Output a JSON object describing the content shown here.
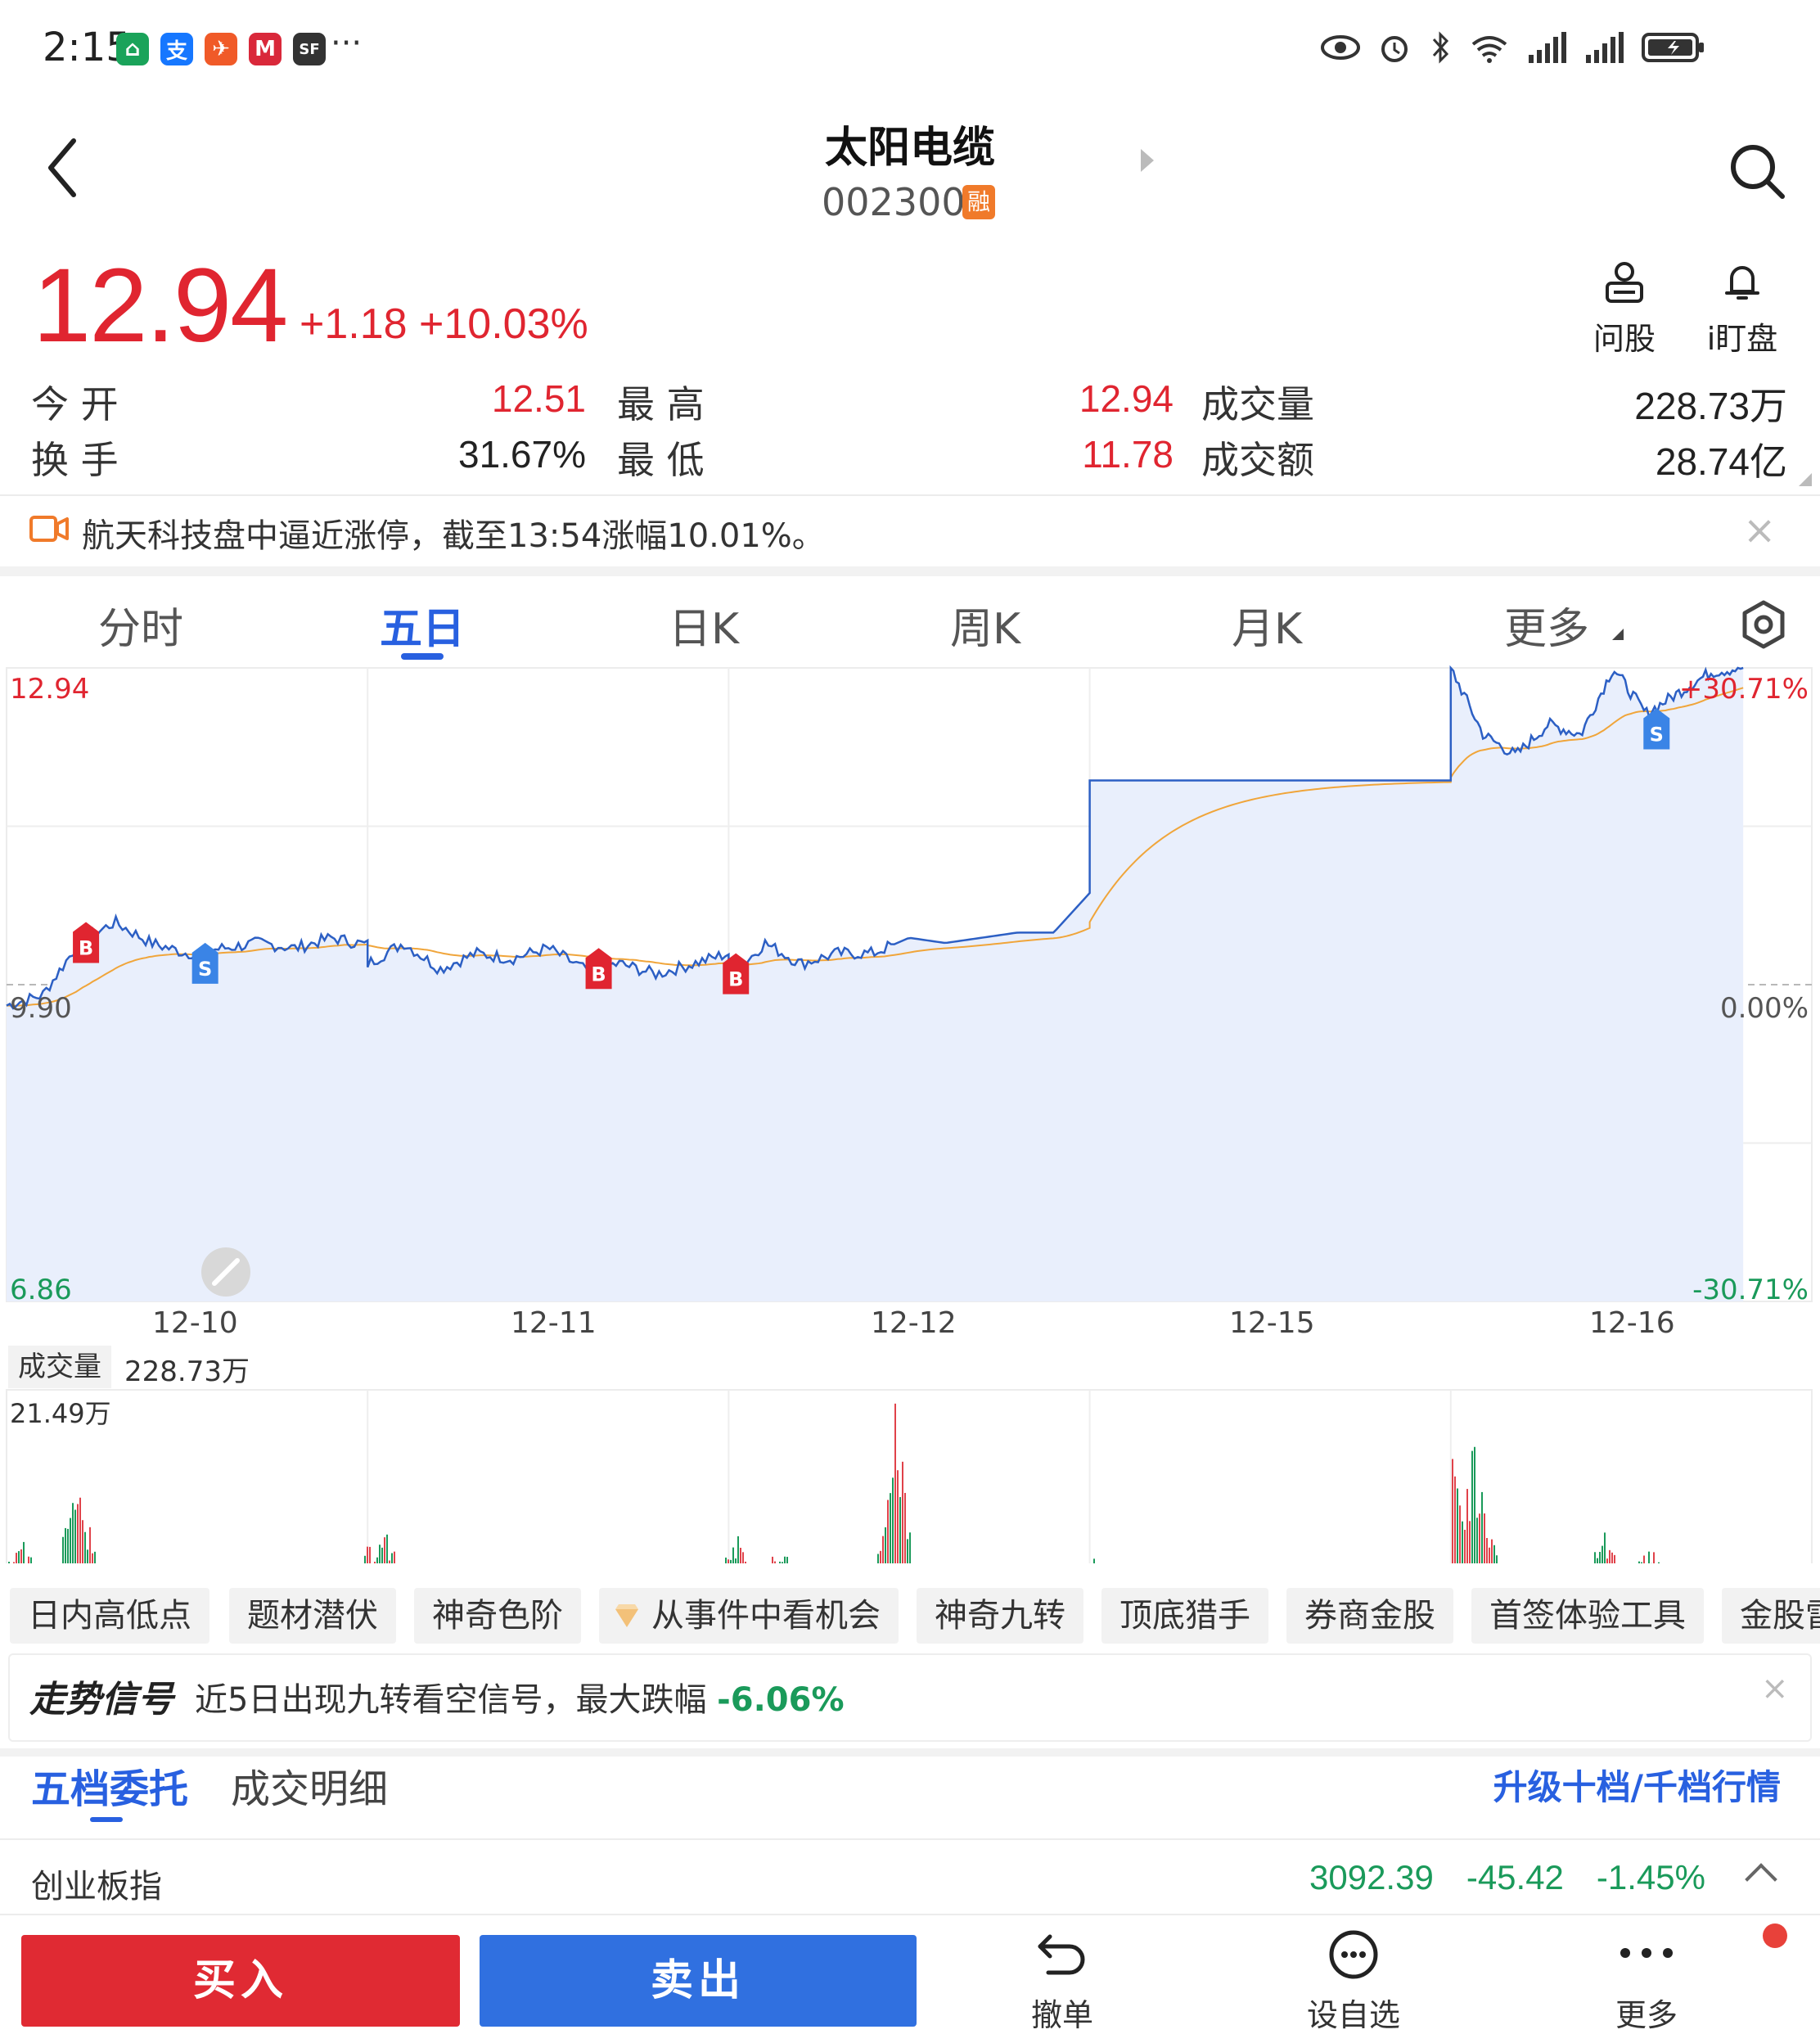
{
  "status_bar": {
    "time": "2:15",
    "app_icons": [
      {
        "name": "bank-app-icon",
        "glyph": "⌂",
        "color": "#1aa35a"
      },
      {
        "name": "alipay-icon",
        "glyph": "支",
        "color": "#1677ff"
      },
      {
        "name": "telegram-app-icon",
        "glyph": "✈",
        "color": "#f05a28"
      },
      {
        "name": "bank-logo-icon",
        "glyph": "M",
        "color": "#d9283a"
      },
      {
        "name": "sf-express-icon",
        "glyph": "SF",
        "color": "#333333"
      }
    ],
    "more": "···"
  },
  "header": {
    "stock_name": "太阳电缆",
    "stock_code": "002300",
    "margin_badge": "融"
  },
  "quote": {
    "price": "12.94",
    "change": "+1.18 +10.03%",
    "ask_label": "问股",
    "watch_label": "i盯盘"
  },
  "stats": [
    {
      "label": "今  开",
      "value": "12.51",
      "color": "red"
    },
    {
      "label": "最  高",
      "value": "12.94",
      "color": "red"
    },
    {
      "label": "成交量",
      "value": "228.73万",
      "color": "dark"
    },
    {
      "label": "换  手",
      "value": "31.67%",
      "color": "dark"
    },
    {
      "label": "最  低",
      "value": "11.78",
      "color": "red"
    },
    {
      "label": "成交额",
      "value": "28.74亿",
      "color": "dark"
    }
  ],
  "notice": {
    "text": "航天科技盘中逼近涨停，截至13:54涨幅10.01%。",
    "close": "×"
  },
  "chart_tabs": [
    {
      "label": "分时",
      "active": false
    },
    {
      "label": "五日",
      "active": true
    },
    {
      "label": "日K",
      "active": false
    },
    {
      "label": "周K",
      "active": false
    },
    {
      "label": "月K",
      "active": false
    },
    {
      "label": "更多",
      "active": false
    }
  ],
  "chart_labels": {
    "y_top": "12.94",
    "y_mid": "9.90",
    "y_bottom": "6.86",
    "pct_top": "+30.71%",
    "pct_mid": "0.00%",
    "pct_bottom": "-30.71%",
    "dates": [
      "12-10",
      "12-11",
      "12-12",
      "12-15",
      "12-16"
    ],
    "volume_label": "成交量",
    "volume_value": "228.73万",
    "volume_max": "21.49万"
  },
  "chart_data": {
    "type": "line",
    "x": [
      "12-10",
      "12-11",
      "12-12",
      "12-15",
      "12-16"
    ],
    "ylim": [
      6.86,
      12.94
    ],
    "series": [
      {
        "values_by_day": [
          [
            9.7,
            9.8,
            10.3,
            10.5,
            10.3,
            10.2,
            10.25,
            10.3,
            10.25,
            10.35,
            10.28
          ],
          [
            10.1,
            10.3,
            10.05,
            10.2,
            10.15,
            10.25,
            10.05,
            10.1,
            10.0,
            10.1,
            10.2
          ],
          [
            9.95,
            10.3,
            10.1,
            10.2,
            10.2,
            10.35,
            10.3,
            10.35,
            10.4,
            10.4,
            10.78
          ],
          [
            11.86,
            11.86,
            11.86,
            11.86,
            11.86
          ],
          [
            12.94,
            12.3,
            12.1,
            12.4,
            12.3,
            12.94,
            12.5,
            12.7,
            12.9,
            12.94
          ]
        ]
      }
    ],
    "signals": [
      {
        "type": "B",
        "day": "12-10"
      },
      {
        "type": "S",
        "day": "12-11"
      },
      {
        "type": "B",
        "day": "12-11"
      },
      {
        "type": "B",
        "day": "12-12"
      },
      {
        "type": "S",
        "day": "12-16"
      }
    ],
    "volume_max": "21.49万"
  },
  "features": [
    "日内高低点",
    "题材潜伏",
    "神奇色阶",
    "从事件中看机会",
    "神奇九转",
    "顶底猎手",
    "券商金股",
    "首签体验工具",
    "金股雷"
  ],
  "signal": {
    "title": "走势信号",
    "text": "近5日出现九转看空信号，最大跌幅",
    "value": "-6.06%"
  },
  "orderbook_tabs": [
    {
      "label": "五档委托",
      "active": true
    },
    {
      "label": "成交明细",
      "active": false
    }
  ],
  "upgrade_link": "升级十档/千档行情",
  "index_row": {
    "name": "创业板指",
    "value": "3092.39",
    "change": "-45.42",
    "pct": "-1.45%"
  },
  "bottom_bar": {
    "buy": "买入",
    "sell": "卖出",
    "cancel": "撤单",
    "watchlist": "设自选",
    "more": "更多"
  }
}
